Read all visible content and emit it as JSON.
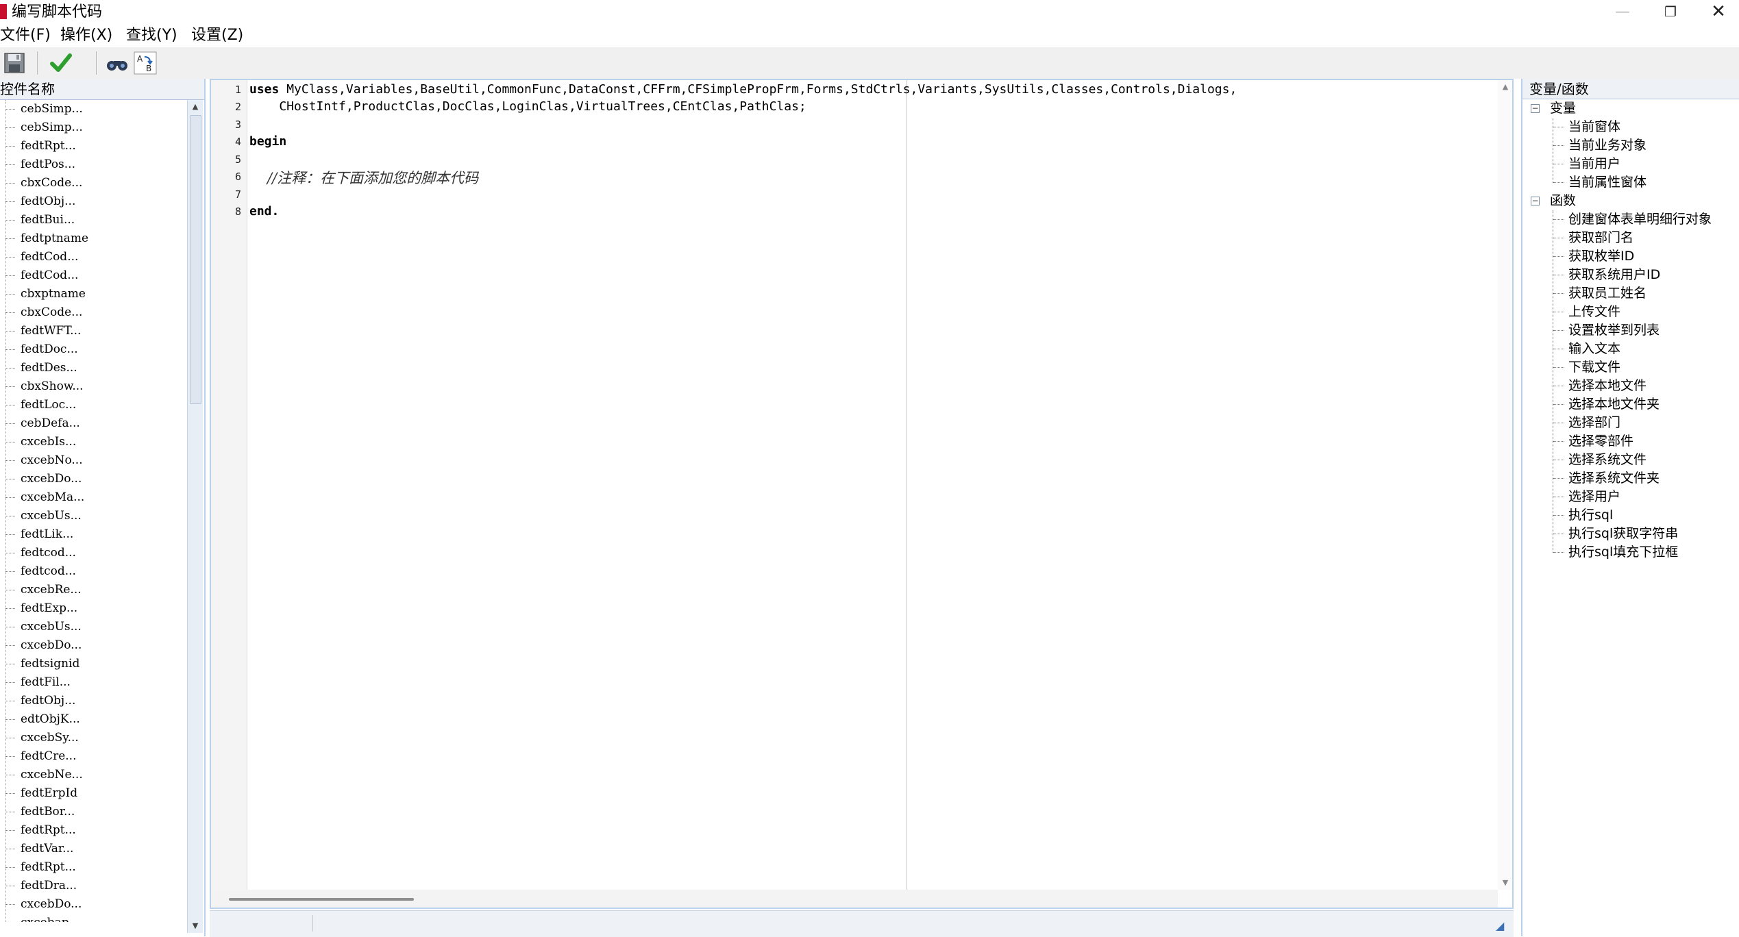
{
  "window": {
    "title": "编写脚本代码",
    "minimize": "—",
    "maximize": "❐",
    "close": "✕"
  },
  "menu": [
    "文件(F)",
    "操作(X)",
    "查找(Y)",
    "设置(Z)"
  ],
  "toolbar": {
    "buttons": [
      {
        "name": "save-icon"
      },
      {
        "name": "check-icon",
        "color": "#2e9e2e"
      },
      {
        "name": "binoculars-icon"
      },
      {
        "name": "replace-icon"
      }
    ]
  },
  "left_panel": {
    "header": "控件名称",
    "items": [
      "cebSimp...",
      "cebSimp...",
      "fedtRpt...",
      "fedtPos...",
      "cbxCode...",
      "fedtObj...",
      "fedtBui...",
      "fedtptname",
      "fedtCod...",
      "fedtCod...",
      "cbxptname",
      "cbxCode...",
      "fedtWFT...",
      "fedtDoc...",
      "fedtDes...",
      "cbxShow...",
      "fedtLoc...",
      "cebDefa...",
      "cxcebIs...",
      "cxcebNo...",
      "cxcebDo...",
      "cxcebMa...",
      "cxcebUs...",
      "fedtLik...",
      "fedtcod...",
      "fedtcod...",
      "cxcebRe...",
      "fedtExp...",
      "cxcebUs...",
      "cxcebDo...",
      "fedtsignid",
      "fedtFil...",
      "fedtObj...",
      "edtObjK...",
      "cxcebSy...",
      "fedtCre...",
      "cxcebNe...",
      "fedtErpId",
      "fedtBor...",
      "fedtRpt...",
      "fedtVar...",
      "fedtRpt...",
      "fedtDra...",
      "cxcebDo...",
      "cxcebap..."
    ]
  },
  "editor": {
    "line_numbers": [
      "1",
      "2",
      "3",
      "4",
      "5",
      "6",
      "7",
      "8"
    ],
    "line1_kw": "uses",
    "line1_rest": " MyClass,Variables,BaseUtil,CommonFunc,DataConst,CFFrm,CFSimplePropFrm,Forms,StdCtrls,Variants,SysUtils,Classes,Controls,Dialogs,",
    "line2": "    CHostIntf,ProductClas,DocClas,LoginClas,VirtualTrees,CEntClas,PathClas;",
    "line4": "begin",
    "line6": "//注释：在下面添加您的脚本代码",
    "line8": "end."
  },
  "right_panel": {
    "header": "变量/函数",
    "variables_label": "变量",
    "variables": [
      "当前窗体",
      "当前业务对象",
      "当前用户",
      "当前属性窗体"
    ],
    "functions_label": "函数",
    "functions": [
      "创建窗体表单明细行对象",
      "获取部门名",
      "获取枚举ID",
      "获取系统用户ID",
      "获取员工姓名",
      "上传文件",
      "设置枚举到列表",
      "输入文本",
      "下载文件",
      "选择本地文件",
      "选择本地文件夹",
      "选择部门",
      "选择零部件",
      "选择系统文件",
      "选择系统文件夹",
      "选择用户",
      "执行sql",
      "执行sql获取字符串",
      "执行sql填充下拉框"
    ]
  }
}
